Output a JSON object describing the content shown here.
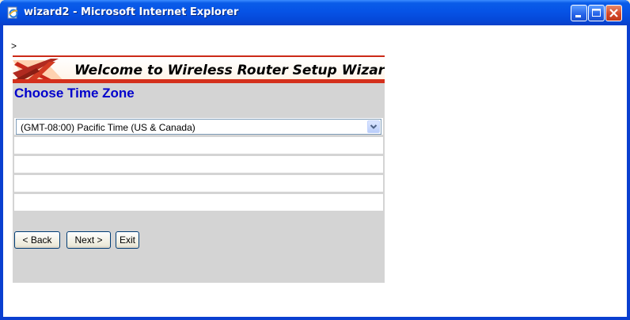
{
  "window": {
    "title": "wizard2 - Microsoft Internet Explorer",
    "icon": "ie-page-icon"
  },
  "page": {
    "stray_text": ">",
    "banner_title": "Welcome to Wireless Router Setup Wizard",
    "section_title": "Choose Time Zone",
    "timezone": {
      "selected": "(GMT-08:00) Pacific Time (US & Canada)"
    },
    "buttons": {
      "back": "< Back",
      "next": "Next >",
      "exit": "Exit"
    }
  },
  "colors": {
    "titlebar": "#0653e6",
    "panel": "#d4d4d4",
    "heading": "#0000cc",
    "banner_red": "#d4301c"
  }
}
